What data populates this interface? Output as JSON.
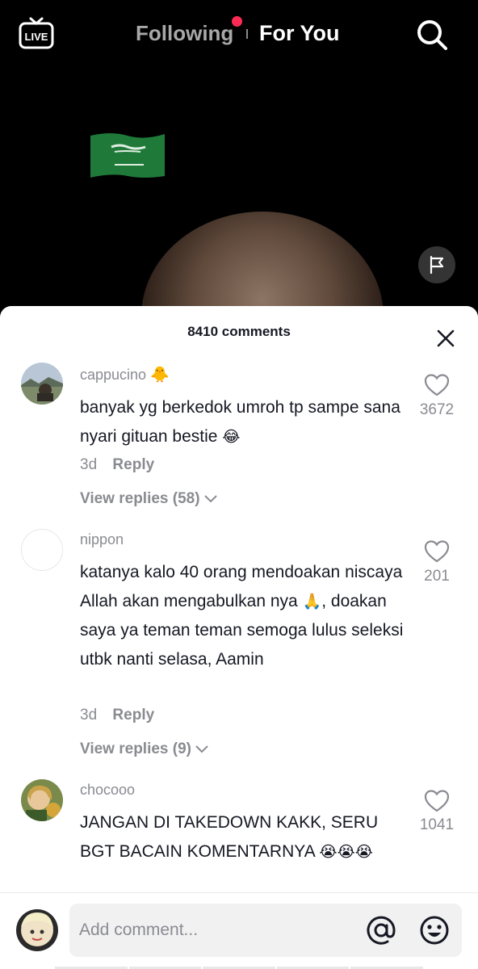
{
  "top_nav": {
    "live_label": "LIVE",
    "following_label": "Following",
    "for_you_label": "For You"
  },
  "comments_panel": {
    "title": "8410 comments",
    "comments": [
      {
        "username": "cappucino",
        "username_emoji": "🐥",
        "text": "banyak yg berkedok umroh tp sampe sana nyari gituan bestie",
        "text_emoji": "😂",
        "date": "3d",
        "reply_label": "Reply",
        "view_replies": "View replies (58)",
        "likes": "3672"
      },
      {
        "username": "nippon",
        "text_part1": "katanya kalo 40 orang mendoakan niscaya Allah akan mengabulkan nya",
        "text_emoji": "🙏",
        "text_part2": ", doakan saya ya teman teman semoga lulus seleksi utbk nanti selasa, Aamin",
        "date": "3d",
        "reply_label": "Reply",
        "view_replies": "View replies (9)",
        "likes": "201"
      },
      {
        "username": "chocooo",
        "text": "JANGAN DI TAKEDOWN KAKK, SERU BGT BACAIN KOMENTARNYA",
        "text_emoji": "😭😭😭",
        "likes": "1041"
      }
    ]
  },
  "comment_input": {
    "placeholder": "Add comment..."
  },
  "colors": {
    "accent_red": "#fe2c55",
    "secondary_text": "#8a8b91",
    "primary_text": "#161823"
  },
  "icons": [
    "live-icon",
    "search-icon",
    "flag-icon",
    "report-flag-icon",
    "close-icon",
    "heart-icon",
    "chevron-down-icon",
    "at-mention-icon",
    "emoji-icon"
  ]
}
